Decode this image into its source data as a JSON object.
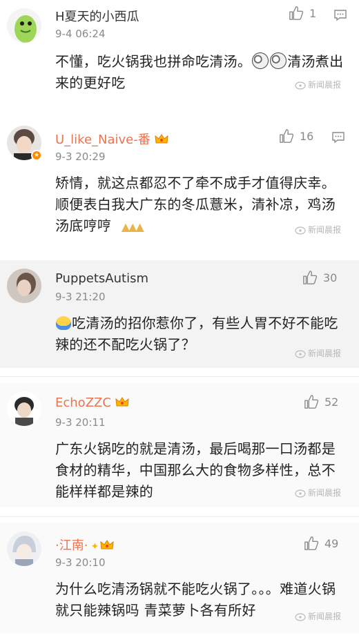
{
  "comments": [
    {
      "username": "H夏天的小西瓜",
      "time": "9-4 06:24",
      "likes": "1",
      "text_part1": "不懂，吃火锅我也拼命吃清汤。",
      "text_part2": "清汤煮出来的更好吃",
      "source": "新闻晨报"
    },
    {
      "username": "U_like_Naive-番",
      "time": "9-3 20:29",
      "likes": "16",
      "text": "矫情，就这点都忍不了牵不成手才值得庆幸。 顺便表白我大广东的冬瓜薏米，清补凉，鸡汤汤底哼哼",
      "source": "新闻晨报"
    },
    {
      "username": "PuppetsAutism",
      "time": "9-3 21:20",
      "likes": "30",
      "text": "吃清汤的招你惹你了，有些人胃不好不能吃辣的还不配吃火锅了？",
      "source": "新闻晨报"
    },
    {
      "username": "EchoZZC",
      "time": "9-3 20:11",
      "likes": "52",
      "text": "广东火锅吃的就是清汤，最后喝那一口汤都是食材的精华，中国那么大的食物多样性，总不能样样都是辣的",
      "source": "新闻晨报"
    },
    {
      "username": "·江南·",
      "time": "9-3 20:10",
      "likes": "49",
      "text": "为什么吃清汤锅就不能吃火锅了。。。难道火锅就只能辣锅吗 青菜萝卜各有所好",
      "source": "新闻晨报"
    }
  ],
  "colors": {
    "orange_name": "#eb7350",
    "grey_bg": "#f3f3f3",
    "meta_grey": "#8a8a8a"
  },
  "icons": [
    "thumbs-up-icon",
    "reply-icon",
    "crown-badge-icon",
    "news-source-icon"
  ]
}
